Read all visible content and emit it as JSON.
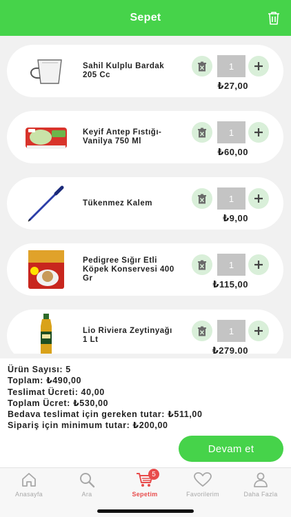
{
  "header": {
    "title": "Sepet"
  },
  "cart": {
    "items": [
      {
        "name": "Sahil Kulplu Bardak 205 Cc",
        "quantity": "1",
        "price": "₺27,00"
      },
      {
        "name": "Keyif Antep Fıstığı-Vanilya 750 Ml",
        "quantity": "1",
        "price": "₺60,00"
      },
      {
        "name": "Tükenmez Kalem",
        "quantity": "1",
        "price": "₺9,00"
      },
      {
        "name": "Pedigree Sığır Etli Köpek Konservesi 400 Gr",
        "quantity": "1",
        "price": "₺115,00"
      },
      {
        "name": "Lio Riviera Zeytinyağı 1 Lt",
        "quantity": "1",
        "price": "₺279.00"
      }
    ]
  },
  "summary": {
    "item_count": "Ürün Sayısı: 5",
    "total": "Toplam: ₺490,00",
    "delivery_fee": "Teslimat Ücreti: 40,00",
    "total_fee": "Toplam Ücret: ₺530,00",
    "free_delivery": "Bedava teslimat için gereken tutar: ₺511,00",
    "min_order": "Sipariş için minimum tutar: ₺200,00",
    "continue_label": "Devam et"
  },
  "nav": {
    "items": [
      {
        "label": "Anasayfa",
        "icon": "home-icon"
      },
      {
        "label": "Ara",
        "icon": "search-icon"
      },
      {
        "label": "Sepetim",
        "icon": "cart-icon",
        "badge": "5",
        "active": true
      },
      {
        "label": "Favorilerim",
        "icon": "heart-icon"
      },
      {
        "label": "Daha Fazla",
        "icon": "user-icon"
      }
    ]
  },
  "colors": {
    "primary": "#46d34a",
    "badge": "#e84b4b",
    "button_bg": "#d9efd9",
    "qty_bg": "#c4c4c4"
  }
}
